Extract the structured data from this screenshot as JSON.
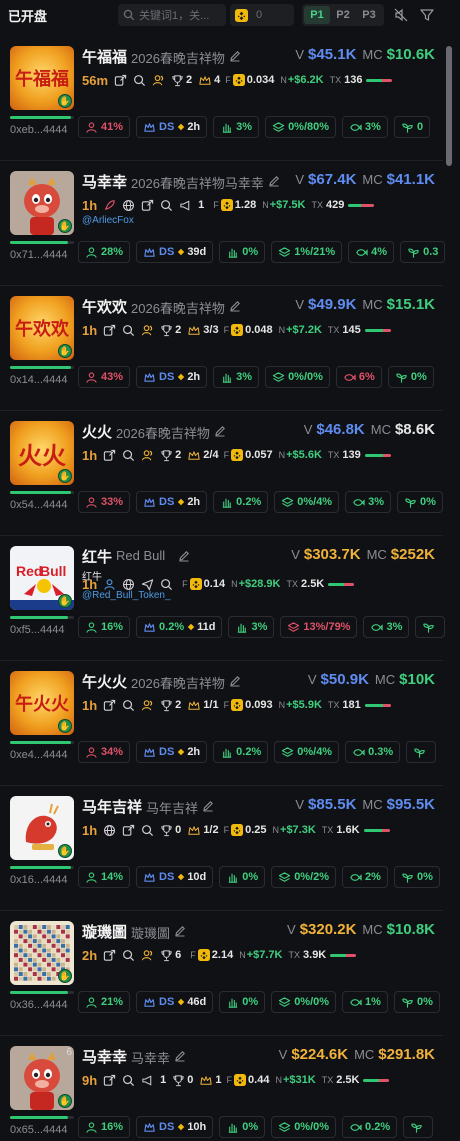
{
  "header": {
    "title": "已开盘",
    "search_placeholder": "关键词1，关...",
    "count_value": "0",
    "pages": [
      "P1",
      "P2",
      "P3"
    ],
    "active_page": "P1"
  },
  "colors": {
    "accent_green": "#3fcf7f",
    "accent_red": "#e0526a",
    "accent_blue": "#4d9be6",
    "accent_gold": "#f0b23a",
    "background": "#101114"
  },
  "labels": {
    "v": "V",
    "mc": "MC",
    "n": "N",
    "tx": "TX",
    "f": "F"
  },
  "tokens": [
    {
      "name": "午福福",
      "subtitle": "2026春晚吉祥物",
      "v": "$45.1K",
      "mc": "$10.6K",
      "v_color": "blue",
      "mc_color": "green",
      "age": "56m",
      "img": "午福福",
      "icons": [
        "share-icon",
        "search-icon",
        "users-icon"
      ],
      "trophy": "2",
      "crown": "4",
      "bnb": "0.034",
      "net": "+$6.2K",
      "tx": "136",
      "tx_buy_ratio": 0.6,
      "address": "0xeb...4444",
      "progress": 0.95,
      "stats": [
        {
          "icon": "user-icon",
          "text": "41%",
          "color": "red"
        },
        {
          "icon": "dev-icon",
          "text": "DS",
          "extra": "2h",
          "color": "blue"
        },
        {
          "icon": "hand-icon",
          "text": "3%",
          "color": "green"
        },
        {
          "icon": "layers-icon",
          "text": "0%/80%",
          "color": "green"
        },
        {
          "icon": "fish-icon",
          "text": "3%",
          "color": "green"
        },
        {
          "icon": "sprout-icon",
          "text": "0",
          "color": "green"
        }
      ]
    },
    {
      "name": "马幸幸",
      "subtitle": "2026春晚吉祥物马幸幸",
      "v": "$67.4K",
      "mc": "$41.1K",
      "v_color": "blue",
      "mc_color": "blue",
      "age": "1h",
      "img": "horse",
      "handle": "@ArliecFox",
      "icons": [
        "rocket-icon",
        "globe-icon",
        "share-icon",
        "search-icon"
      ],
      "mega": "1",
      "bnb": "1.28",
      "net": "+$7.5K",
      "tx": "429",
      "tx_buy_ratio": 0.5,
      "address": "0x71...4444",
      "progress": 0.9,
      "stats": [
        {
          "icon": "user-icon",
          "text": "28%",
          "color": "green"
        },
        {
          "icon": "dev-icon",
          "text": "DS",
          "extra": "39d",
          "color": "blue"
        },
        {
          "icon": "hand-icon",
          "text": "0%",
          "color": "green"
        },
        {
          "icon": "layers-icon",
          "text": "1%/21%",
          "color": "green"
        },
        {
          "icon": "fish-icon",
          "text": "4%",
          "color": "green"
        },
        {
          "icon": "sprout-icon",
          "text": "0.3",
          "color": "green"
        }
      ]
    },
    {
      "name": "午欢欢",
      "subtitle": "2026春晚吉祥物",
      "v": "$49.9K",
      "mc": "$15.1K",
      "v_color": "blue",
      "mc_color": "green",
      "age": "1h",
      "img": "午欢欢",
      "icons": [
        "share-icon",
        "search-icon",
        "users-icon"
      ],
      "trophy": "2",
      "crown": "3/3",
      "bnb": "0.048",
      "net": "+$7.2K",
      "tx": "145",
      "tx_buy_ratio": 0.7,
      "address": "0x14...4444",
      "progress": 0.95,
      "stats": [
        {
          "icon": "user-icon",
          "text": "43%",
          "color": "red"
        },
        {
          "icon": "dev-icon",
          "text": "DS",
          "extra": "2h",
          "color": "blue"
        },
        {
          "icon": "hand-icon",
          "text": "3%",
          "color": "green"
        },
        {
          "icon": "layers-icon",
          "text": "0%/0%",
          "color": "green"
        },
        {
          "icon": "fish-icon",
          "text": "6%",
          "color": "red"
        },
        {
          "icon": "sprout-icon",
          "text": "0%",
          "color": "green"
        }
      ]
    },
    {
      "name": "火火",
      "subtitle": "2026春晚吉祥物",
      "v": "$46.8K",
      "mc": "$8.6K",
      "v_color": "blue",
      "mc_color": "white",
      "age": "1h",
      "img": "火火",
      "icons": [
        "share-icon",
        "search-icon",
        "users-icon"
      ],
      "trophy": "2",
      "crown": "2/4",
      "bnb": "0.057",
      "net": "+$5.6K",
      "tx": "139",
      "tx_buy_ratio": 0.7,
      "address": "0x54...4444",
      "progress": 0.95,
      "stats": [
        {
          "icon": "user-icon",
          "text": "33%",
          "color": "red"
        },
        {
          "icon": "dev-icon",
          "text": "DS",
          "extra": "2h",
          "color": "blue"
        },
        {
          "icon": "hand-icon",
          "text": "0.2%",
          "color": "green"
        },
        {
          "icon": "layers-icon",
          "text": "0%/4%",
          "color": "green"
        },
        {
          "icon": "fish-icon",
          "text": "3%",
          "color": "green"
        },
        {
          "icon": "sprout-icon",
          "text": "0%",
          "color": "green"
        }
      ]
    },
    {
      "name": "红牛",
      "subtitle": "Red Bull",
      "v": "$303.7K",
      "mc": "$252K",
      "v_color": "gold",
      "mc_color": "gold",
      "age": "1h",
      "img": "redbull",
      "hold_label": "红牛",
      "handle": "@Red_Bull_Token_",
      "icons": [
        "user-icon",
        "globe-icon",
        "send-icon",
        "search-icon"
      ],
      "bnb": "0.14",
      "net": "+$28.9K",
      "tx": "2.5K",
      "tx_buy_ratio": 0.6,
      "address": "0xf5...4444",
      "progress": 0.9,
      "stats": [
        {
          "icon": "user-icon",
          "text": "16%",
          "color": "green"
        },
        {
          "icon": "dev-icon",
          "text": "0.2%",
          "extra": "11d",
          "color": "green"
        },
        {
          "icon": "hand-icon",
          "text": "3%",
          "color": "green"
        },
        {
          "icon": "layers-icon",
          "text": "13%/79%",
          "color": "red"
        },
        {
          "icon": "fish-icon",
          "text": "3%",
          "color": "green"
        },
        {
          "icon": "sprout-icon",
          "text": "",
          "color": "green"
        }
      ]
    },
    {
      "name": "午火火",
      "subtitle": "2026春晚吉祥物",
      "v": "$50.9K",
      "mc": "$10K",
      "v_color": "blue",
      "mc_color": "green",
      "age": "1h",
      "img": "午火火",
      "icons": [
        "share-icon",
        "search-icon",
        "users-icon"
      ],
      "trophy": "2",
      "crown": "1/1",
      "bnb": "0.093",
      "net": "+$5.9K",
      "tx": "181",
      "tx_buy_ratio": 0.7,
      "address": "0xe4...4444",
      "progress": 0.95,
      "stats": [
        {
          "icon": "user-icon",
          "text": "34%",
          "color": "red"
        },
        {
          "icon": "dev-icon",
          "text": "DS",
          "extra": "2h",
          "color": "blue"
        },
        {
          "icon": "hand-icon",
          "text": "0.2%",
          "color": "green"
        },
        {
          "icon": "layers-icon",
          "text": "0%/4%",
          "color": "green"
        },
        {
          "icon": "fish-icon",
          "text": "0.3%",
          "color": "green"
        },
        {
          "icon": "sprout-icon",
          "text": "",
          "color": "green"
        }
      ]
    },
    {
      "name": "马年吉祥",
      "subtitle": "马年吉祥",
      "v": "$85.5K",
      "mc": "$95.5K",
      "v_color": "blue",
      "mc_color": "blue",
      "age": "1h",
      "img": "dragon",
      "icons": [
        "globe-icon",
        "share-icon",
        "search-icon"
      ],
      "trophy": "0",
      "crown": "1/2",
      "bnb": "0.25",
      "net": "+$7.3K",
      "tx": "1.6K",
      "tx_buy_ratio": 0.7,
      "address": "0x16...4444",
      "progress": 0.95,
      "stats": [
        {
          "icon": "user-icon",
          "text": "14%",
          "color": "green"
        },
        {
          "icon": "dev-icon",
          "text": "DS",
          "extra": "10d",
          "color": "blue"
        },
        {
          "icon": "hand-icon",
          "text": "0%",
          "color": "green"
        },
        {
          "icon": "layers-icon",
          "text": "0%/2%",
          "color": "green"
        },
        {
          "icon": "fish-icon",
          "text": "2%",
          "color": "green"
        },
        {
          "icon": "sprout-icon",
          "text": "0%",
          "color": "green"
        }
      ]
    },
    {
      "name": "璇璣圖",
      "subtitle": "璇璣圖",
      "v": "$320.2K",
      "mc": "$10.8K",
      "v_color": "gold",
      "mc_color": "green",
      "age": "2h",
      "img": "grid",
      "icons": [
        "share-icon",
        "search-icon",
        "users-icon"
      ],
      "trophy": "6",
      "bnb": "2.14",
      "net": "+$7.7K",
      "tx": "3.9K",
      "tx_buy_ratio": 0.6,
      "address": "0x36...4444",
      "progress": 0.9,
      "stats": [
        {
          "icon": "user-icon",
          "text": "21%",
          "color": "green"
        },
        {
          "icon": "dev-icon",
          "text": "DS",
          "extra": "46d",
          "color": "blue"
        },
        {
          "icon": "hand-icon",
          "text": "0%",
          "color": "green"
        },
        {
          "icon": "layers-icon",
          "text": "0%/0%",
          "color": "green"
        },
        {
          "icon": "fish-icon",
          "text": "1%",
          "color": "green"
        },
        {
          "icon": "sprout-icon",
          "text": "0%",
          "color": "green"
        }
      ]
    },
    {
      "name": "马幸幸",
      "subtitle": "马幸幸",
      "v": "$224.6K",
      "mc": "$291.8K",
      "v_color": "gold",
      "mc_color": "gold",
      "age": "9h",
      "img": "horse",
      "corner": "6",
      "icons": [
        "share-icon",
        "search-icon"
      ],
      "mega": "1",
      "trophy": "0",
      "crown": "1",
      "bnb": "0.44",
      "net": "+$31K",
      "tx": "2.5K",
      "tx_buy_ratio": 0.6,
      "address": "0x65...4444",
      "progress": 0.9,
      "stats": [
        {
          "icon": "user-icon",
          "text": "16%",
          "color": "green"
        },
        {
          "icon": "dev-icon",
          "text": "DS",
          "extra": "10h",
          "color": "blue"
        },
        {
          "icon": "hand-icon",
          "text": "0%",
          "color": "green"
        },
        {
          "icon": "layers-icon",
          "text": "0%/0%",
          "color": "green"
        },
        {
          "icon": "fish-icon",
          "text": "0.2%",
          "color": "green"
        },
        {
          "icon": "sprout-icon",
          "text": "",
          "color": "green"
        }
      ]
    }
  ]
}
